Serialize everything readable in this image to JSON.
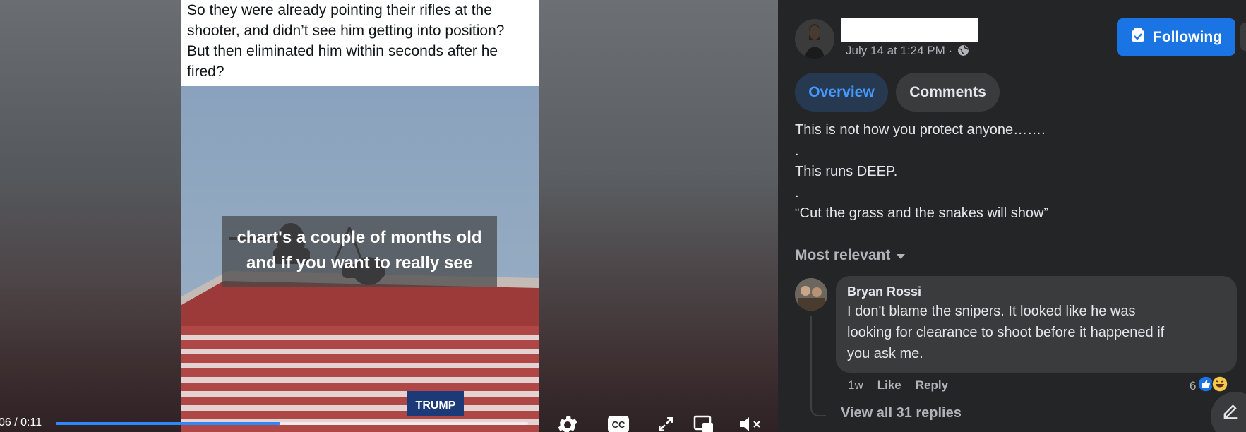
{
  "video": {
    "tweet_text_lines": [
      "So they were already pointing their rifles at the",
      "shooter, and didn’t see him getting into position?",
      "But then eliminated him within seconds after he",
      "fired?"
    ],
    "caption_lines": [
      "chart's a couple of months old",
      "and if you want to really see"
    ],
    "scene_banner_text": "TRUMP",
    "time": "06 / 0:11",
    "progress": 0.475,
    "controls": [
      "settings-icon",
      "cc-icon",
      "fullscreen-icon",
      "picture-in-picture-icon",
      "mute-icon"
    ],
    "cc_label": "CC",
    "accent_color": "#2d88ff"
  },
  "post": {
    "meta": "July 14 at 1:24 PM ·",
    "follow_label": "Following",
    "tabs": [
      {
        "label": "Overview",
        "active": true
      },
      {
        "label": "Comments",
        "active": false
      }
    ],
    "body_lines": [
      "This is not how you protect anyone…….",
      ".",
      "This runs DEEP.",
      ".",
      "“Cut the grass and the snakes will show”"
    ],
    "sort_label": "Most relevant",
    "comment": {
      "author": "Bryan Rossi",
      "text_lines": [
        "I don't blame the snipers. It looked like he was",
        "looking for clearance to shoot before it happened if",
        "you ask me."
      ],
      "time": "1w",
      "like_label": "Like",
      "reply_label": "Reply",
      "reaction_count": "6",
      "view_replies": "View all 31 replies"
    },
    "brand_color": "#1b74e4"
  }
}
